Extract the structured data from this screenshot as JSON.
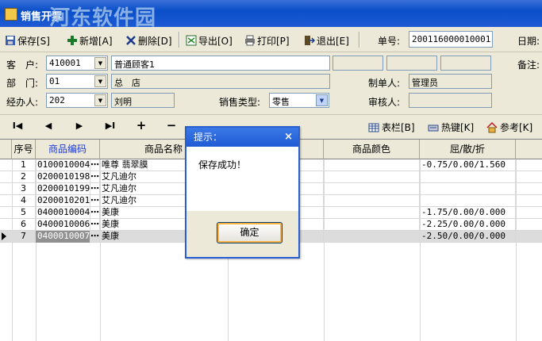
{
  "window": {
    "title": "销售开票",
    "watermark": "河东软件园"
  },
  "toolbar": {
    "save": "保存[S]",
    "add": "新增[A]",
    "delete": "删除[D]",
    "export": "导出[O]",
    "print": "打印[P]",
    "exit": "退出[E]",
    "doc_no_label": "单号:",
    "doc_no": "200116000010001",
    "date_label": "日期:"
  },
  "form": {
    "customer_label": "客　户:",
    "customer_code": "410001",
    "customer_name": "普通顾客1",
    "dept_label": "部　门:",
    "dept_code": "01",
    "dept_name": "总　店",
    "handler_label": "经办人:",
    "handler_code": "202",
    "handler_name": "刘明",
    "sales_type_label": "销售类型:",
    "sales_type": "零售",
    "creator_label": "制单人:",
    "creator": "管理员",
    "reviewer_label": "审核人:",
    "reviewer": "",
    "remark_label": "备注:"
  },
  "nav": {
    "first": "I◀",
    "prev": "◀",
    "next": "▶",
    "last": "▶I",
    "add": "+",
    "remove": "−",
    "columns": "表栏[B]",
    "hotkeys": "热键[K]",
    "reference": "参考[K]"
  },
  "grid": {
    "headers": [
      "序号",
      "商品编码",
      "商品名称",
      "",
      "商品颜色",
      "屈/散/折"
    ],
    "rows": [
      {
        "no": "1",
        "code": "0100010004",
        "name": "唯尊 翡翠膜",
        "ratio": "-0.75/0.00/1.560"
      },
      {
        "no": "2",
        "code": "0200010198",
        "name": "艾凡迪尔",
        "ratio": ""
      },
      {
        "no": "3",
        "code": "0200010199",
        "name": "艾凡迪尔",
        "ratio": ""
      },
      {
        "no": "4",
        "code": "0200010201",
        "name": "艾凡迪尔",
        "ratio": ""
      },
      {
        "no": "5",
        "code": "0400010004",
        "name": "美康",
        "ratio": "-1.75/0.00/0.000"
      },
      {
        "no": "6",
        "code": "0400010006",
        "name": "美康",
        "ratio": "-2.25/0.00/0.000"
      },
      {
        "no": "7",
        "code": "0400010007",
        "name": "美康",
        "ratio": "-2.50/0.00/0.000"
      }
    ],
    "ellipsis": "⋯"
  },
  "dialog": {
    "title": "提示：",
    "close": "×",
    "message": "保存成功！",
    "ok": "确定"
  }
}
